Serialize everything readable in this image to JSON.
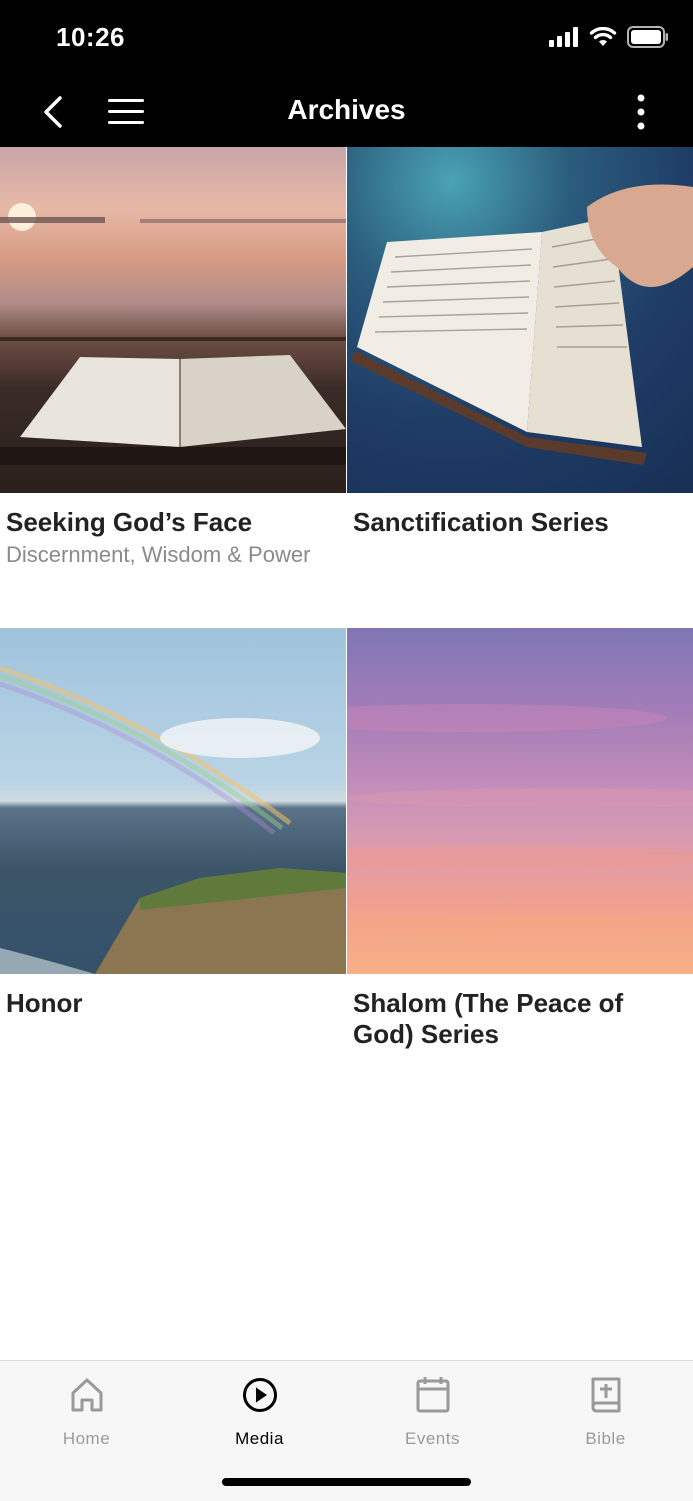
{
  "status": {
    "time": "10:26"
  },
  "nav": {
    "title": "Archives"
  },
  "cards": [
    {
      "title": "Seeking God’s Face",
      "subtitle": "Discernment, Wisdom & Power"
    },
    {
      "title": "Sanctification Series",
      "subtitle": ""
    },
    {
      "title": "Honor",
      "subtitle": ""
    },
    {
      "title": "Shalom (The Peace of God) Series",
      "subtitle": ""
    }
  ],
  "tabs": [
    {
      "label": "Home",
      "icon": "home-icon",
      "active": false
    },
    {
      "label": "Media",
      "icon": "play-circle-icon",
      "active": true
    },
    {
      "label": "Events",
      "icon": "calendar-icon",
      "active": false
    },
    {
      "label": "Bible",
      "icon": "bible-icon",
      "active": false
    }
  ]
}
